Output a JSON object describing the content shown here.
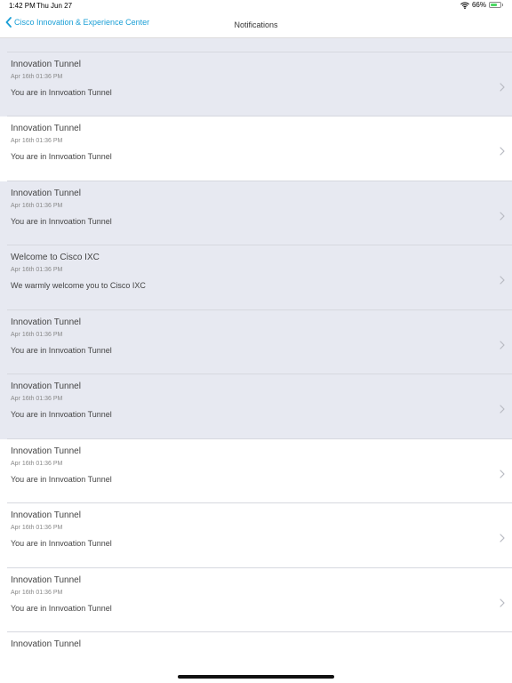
{
  "status_bar": {
    "time": "1:42 PM",
    "date": "Thu Jun 27",
    "battery": "66%",
    "battery_level": 0.66,
    "wifi_icon": "wifi-icon",
    "battery_icon": "battery-icon"
  },
  "nav": {
    "back_label": "Cisco Innovation & Experience Center",
    "title": "Notifications",
    "back_icon": "chevron-left-icon"
  },
  "colors": {
    "accent": "#1a9fd6",
    "unread_background": "#e7e9f1",
    "read_background": "#ffffff"
  },
  "notifications": [
    {
      "title": "",
      "date": "",
      "message": "You are in Innvoation Tunnel",
      "unread": true
    },
    {
      "title": "Innovation Tunnel",
      "date": "Apr 16th 01:36 PM",
      "message": "You are in Innvoation Tunnel",
      "unread": true
    },
    {
      "title": "Innovation Tunnel",
      "date": "Apr 16th 01:36 PM",
      "message": "You are in Innvoation Tunnel",
      "unread": false
    },
    {
      "title": "Innovation Tunnel",
      "date": "Apr 16th 01:36 PM",
      "message": "You are in Innvoation Tunnel",
      "unread": true
    },
    {
      "title": "Welcome to Cisco IXC",
      "date": "Apr 16th 01:36 PM",
      "message": "We warmly welcome you to Cisco IXC",
      "unread": true
    },
    {
      "title": "Innovation Tunnel",
      "date": "Apr 16th 01:36 PM",
      "message": "You are in Innvoation Tunnel",
      "unread": true
    },
    {
      "title": "Innovation Tunnel",
      "date": "Apr 16th 01:36 PM",
      "message": "You are in Innvoation Tunnel",
      "unread": true
    },
    {
      "title": "Innovation Tunnel",
      "date": "Apr 16th 01:36 PM",
      "message": "You are in Innvoation Tunnel",
      "unread": false
    },
    {
      "title": "Innovation Tunnel",
      "date": "Apr 16th 01:36 PM",
      "message": "You are in Innvoation Tunnel",
      "unread": false
    },
    {
      "title": "Innovation Tunnel",
      "date": "Apr 16th 01:36 PM",
      "message": "You are in Innvoation Tunnel",
      "unread": false
    },
    {
      "title": "Innovation Tunnel",
      "date": "",
      "message": "",
      "unread": false
    }
  ]
}
